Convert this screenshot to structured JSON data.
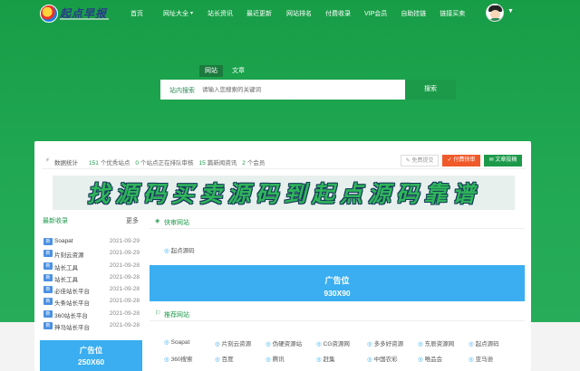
{
  "header": {
    "logo_text": "起点早报",
    "nav": [
      {
        "label": "首页",
        "caret": false
      },
      {
        "label": "网址大全",
        "caret": true
      },
      {
        "label": "站长资讯",
        "caret": false
      },
      {
        "label": "最近更新",
        "caret": false
      },
      {
        "label": "网站排名",
        "caret": false
      },
      {
        "label": "付费收录",
        "caret": false
      },
      {
        "label": "VIP会员",
        "caret": false
      },
      {
        "label": "自助挂链",
        "caret": false
      },
      {
        "label": "链接买卖",
        "caret": false
      }
    ]
  },
  "search": {
    "tabs": [
      "网站",
      "文章"
    ],
    "active_tab": "网站",
    "label": "站内搜索",
    "placeholder": "请输入您搜索的关键词",
    "button": "搜索"
  },
  "stats": {
    "title": "数据统计",
    "items": [
      {
        "num": "151",
        "text": "个优秀站点"
      },
      {
        "num": "0",
        "text": "个站点正在排队审核"
      },
      {
        "num": "15",
        "text": "篇新闻资讯"
      },
      {
        "num": "2",
        "text": "个会员"
      }
    ],
    "btn_free": "免费提交",
    "btn_paid": "付费快审",
    "btn_article": "文章投稿"
  },
  "banner": {
    "text": "找源码买卖源码到起点源码靠谱"
  },
  "sidebar": {
    "title": "最新收录",
    "more": "更多",
    "badge": "新",
    "items": [
      {
        "name": "Soapat",
        "date": "2021-09-29"
      },
      {
        "name": "片刻云资源",
        "date": "2021-09-29"
      },
      {
        "name": "站长工具",
        "date": "2021-09-28"
      },
      {
        "name": "站长工具",
        "date": "2021-09-28"
      },
      {
        "name": "必佳站长平台",
        "date": "2021-09-28"
      },
      {
        "name": "头条站长平台",
        "date": "2021-09-28"
      },
      {
        "name": "360站长平台",
        "date": "2021-09-28"
      },
      {
        "name": "神马站长平台",
        "date": "2021-09-28"
      }
    ]
  },
  "ad_small": {
    "line1": "广告位",
    "line2": "250X60"
  },
  "quick": {
    "title": "快审网站",
    "item": "起点源码"
  },
  "ad_large": {
    "line1": "广告位",
    "line2": "930X90"
  },
  "recommend": {
    "title": "推荐网站",
    "items": [
      "Soapat",
      "片刻云资源",
      "伪硬资源站",
      "CG资源网",
      "多多好资源",
      "东辰资源网",
      "起点源码",
      "360搜索",
      "百度",
      "腾讯",
      "赶集",
      "中国农彩",
      "唯品会",
      "亚马逊"
    ]
  },
  "colors": {
    "brand_green": "#1c9a4a",
    "ad_blue": "#3aaef0",
    "paid_orange": "#f05a2a"
  }
}
